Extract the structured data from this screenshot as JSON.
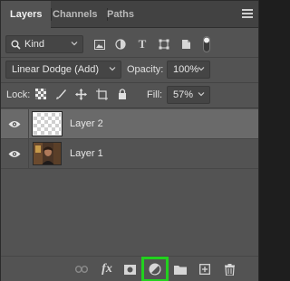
{
  "tabs": [
    {
      "label": "Layers",
      "active": true
    },
    {
      "label": "Channels",
      "active": false
    },
    {
      "label": "Paths",
      "active": false
    }
  ],
  "filter": {
    "kind_label": "Kind"
  },
  "blend": {
    "mode": "Linear Dodge (Add)",
    "opacity_label": "Opacity:",
    "opacity_value": "100%"
  },
  "lock": {
    "label": "Lock:",
    "fill_label": "Fill:",
    "fill_value": "57%"
  },
  "layers": [
    {
      "name": "Layer 2",
      "visible": true,
      "selected": true,
      "thumbnail": "transparent"
    },
    {
      "name": "Layer 1",
      "visible": true,
      "selected": false,
      "thumbnail": "photo"
    }
  ],
  "bottom_icons": [
    "link-icon",
    "fx-icon",
    "mask-icon",
    "adjustment-layer-icon",
    "folder-icon",
    "new-layer-icon",
    "trash-icon"
  ],
  "colors": {
    "panel_bg": "#535353",
    "selected_row": "#6a6a6a",
    "highlight": "#22d11e"
  }
}
